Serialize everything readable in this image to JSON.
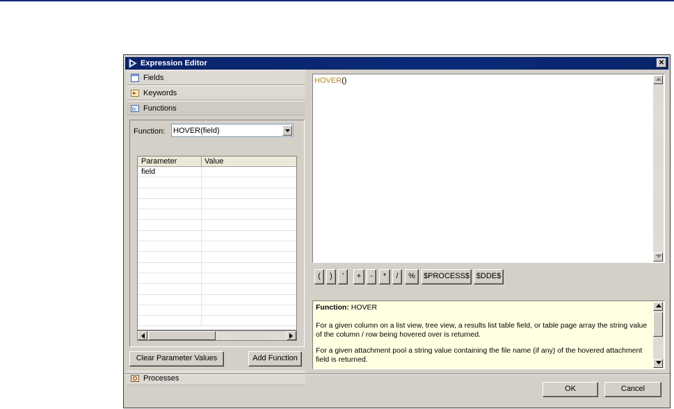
{
  "window": {
    "title": "Expression Editor",
    "close_glyph": "✕",
    "icon": "expression-editor-icon"
  },
  "accordion": {
    "fields": {
      "label": "Fields",
      "icon": "fields-icon"
    },
    "keywords": {
      "label": "Keywords",
      "icon": "keywords-icon"
    },
    "functions": {
      "label": "Functions",
      "icon": "functions-icon"
    },
    "processes": {
      "label": "Processes",
      "icon": "processes-icon"
    }
  },
  "function_panel": {
    "label": "Function:",
    "selected": "HOVER(field)",
    "columns": [
      "Parameter",
      "Value"
    ],
    "rows": [
      {
        "parameter": "field",
        "value": ""
      }
    ]
  },
  "buttons": {
    "clear_params": "Clear Parameter Values",
    "add_function": "Add Function",
    "ok": "OK",
    "cancel": "Cancel"
  },
  "editor": {
    "keyword": "HOVER",
    "rest": "()"
  },
  "operators": [
    "(",
    ")",
    "'",
    "+",
    "-",
    "*",
    "/",
    "%",
    "$PROCESS$",
    "$DDE$"
  ],
  "help": {
    "title_prefix": "Function:",
    "title_value": "HOVER",
    "para1": "For a given column on a list view, tree view, a results list table field, or table page array the string value of the column / row being hovered over is returned.",
    "para2": "For a given attachment pool a string value containing the file name (if any) of the hovered attachment field is returned."
  },
  "colors": {
    "title_bar": "#0a246a",
    "dialog_face": "#d4d0c8",
    "help_background": "#ffffe1",
    "keyword_color": "#b28a1c"
  }
}
